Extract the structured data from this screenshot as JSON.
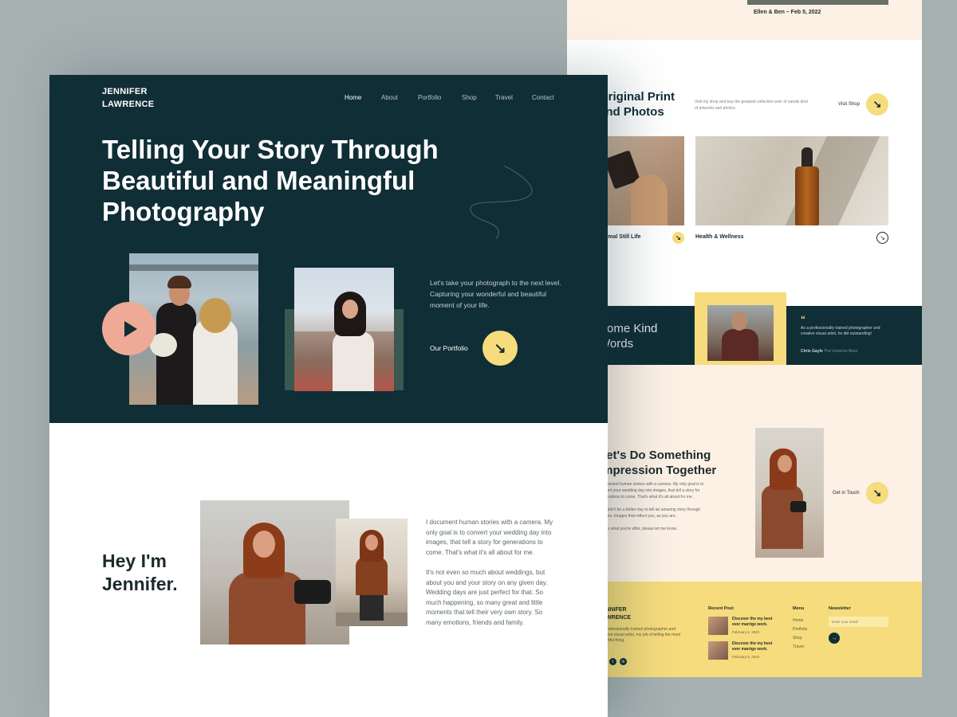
{
  "back_page": {
    "top_caption": "Ellen & Ben – Feb 5, 2022",
    "shop": {
      "heading": "Original Print and Photos",
      "description": "Visit my shop and buy the greatest collection ever of vanals kind of artworks and photos.",
      "button_label": "Visit Shop",
      "products": [
        {
          "label": "Animal Still Life"
        },
        {
          "label": "Health & Wellness"
        }
      ]
    },
    "testimonials": {
      "heading": "Some Kind Words",
      "quote_mark": "“",
      "quote": "As a professionally trained photographer and creative visual artist, he did outstanding!",
      "author": "Chris Gayle",
      "author_org": "The Universe Boss"
    },
    "cta": {
      "heading": "Let's Do Something Impression Together",
      "body": "I document human stories with a camera. My only goal is to convert your wedding day into images, that tell a story for generations to come. That's what it's all about for me.",
      "body2": "It couldn't be a better day to tell an amazing story through images. Images that reflect you, as you are.",
      "body3": "That's what you're after, please let me know.",
      "button_label": "Get in Touch"
    },
    "footer": {
      "logo": "JENNIFER LAWRENCE",
      "description": "I'm professionally trained photographer and creative visual artist, my job of telling the most beautiful thing.",
      "recent_post_heading": "Recent Post",
      "posts": [
        {
          "title": "Discover the my best ever marrige work.",
          "date": "February 5, 2022"
        },
        {
          "title": "Discover the my best ever marrige work.",
          "date": "February 5, 2022"
        }
      ],
      "menu_heading": "Menu",
      "menu_items": [
        "Home",
        "Portfolio",
        "Shop",
        "Travel"
      ],
      "newsletter_heading": "Newsletter",
      "newsletter_placeholder": "Enter your email",
      "newsletter_icon": "arrow-right-icon",
      "social_icons": [
        "facebook-icon",
        "twitter-icon",
        "linkedin-icon"
      ]
    }
  },
  "front_page": {
    "logo_line1": "JENNIFER",
    "logo_line2": "LAWRENCE",
    "nav": [
      {
        "label": "Home",
        "active": true
      },
      {
        "label": "About",
        "active": false
      },
      {
        "label": "Portfolio",
        "active": false
      },
      {
        "label": "Shop",
        "active": false
      },
      {
        "label": "Travel",
        "active": false
      },
      {
        "label": "Contact",
        "active": false
      }
    ],
    "headline": "Telling Your Story Through Beautiful and Meaningful Photography",
    "hero_text": "Let's take your photograph to the next level. Capturing your wonderful and beautiful moment of your life.",
    "portfolio_label": "Our Portfolio",
    "about_heading_line1": "Hey I'm",
    "about_heading_line2": "Jennifer.",
    "about_p1": "I document human stories with a camera. My only goal is to convert your wedding day into images, that tell a story for generations to come. That's what it's all about for me.",
    "about_p2": "It's not even so much about weddings, but about you and your story on any given day. Wedding days are just perfect for that. So much happening, so many great and little moments that tell their very own story. So many emotions, friends and family."
  },
  "colors": {
    "background": "#a6b0b1",
    "dark_teal": "#102e36",
    "accent_yellow": "#f6dc7c",
    "play_pink": "#eeaa96",
    "cream": "#fdf1e6"
  },
  "icons": {
    "arrow": "arrow-down-right-icon",
    "play": "play-icon",
    "quote": "quote-icon"
  }
}
